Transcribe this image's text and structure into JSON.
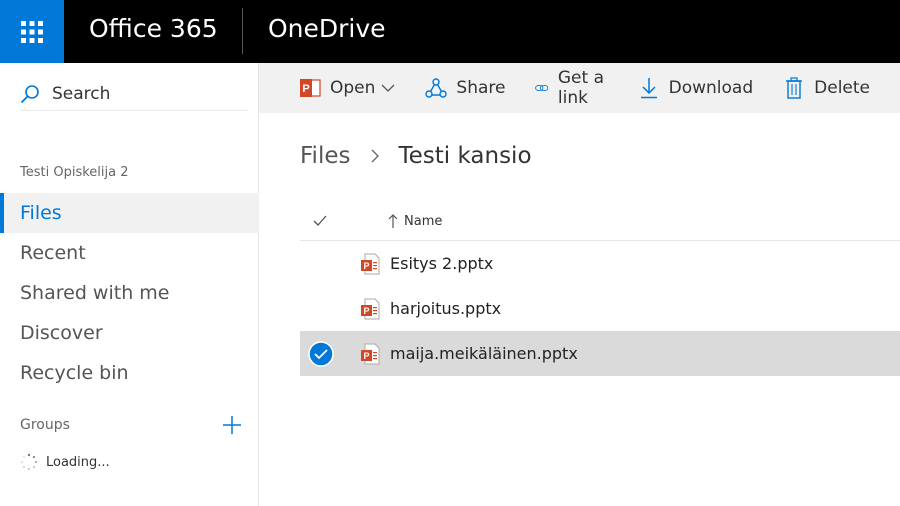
{
  "suitebar": {
    "brand": "Office 365",
    "app_name": "OneDrive",
    "accent": "#0078d7"
  },
  "leftnav": {
    "search_label": "Search",
    "user_name": "Testi Opiskelija 2",
    "items": [
      {
        "label": "Files",
        "active": true
      },
      {
        "label": "Recent",
        "active": false
      },
      {
        "label": "Shared with me",
        "active": false
      },
      {
        "label": "Discover",
        "active": false
      },
      {
        "label": "Recycle bin",
        "active": false
      }
    ],
    "groups_label": "Groups",
    "loading_label": "Loading..."
  },
  "commandbar": {
    "open_label": "Open",
    "share_label": "Share",
    "get_link_label": "Get a link",
    "download_label": "Download",
    "delete_label": "Delete"
  },
  "breadcrumb": {
    "root": "Files",
    "current": "Testi kansio"
  },
  "filelist": {
    "name_header": "Name",
    "files": [
      {
        "name": "Esitys 2.pptx",
        "selected": false,
        "icon": "powerpoint-file-icon"
      },
      {
        "name": "harjoitus.pptx",
        "selected": false,
        "icon": "powerpoint-file-icon"
      },
      {
        "name": "maija.meikäläinen.pptx",
        "selected": true,
        "icon": "powerpoint-file-icon"
      }
    ]
  }
}
